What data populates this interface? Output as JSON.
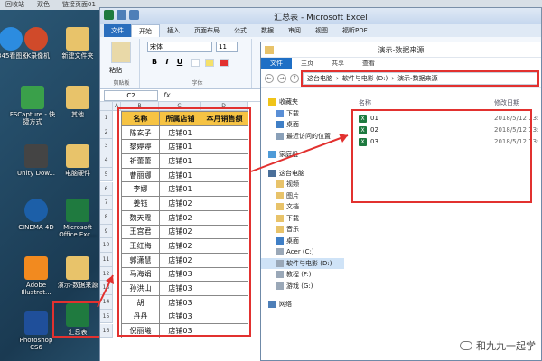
{
  "taskbar": {
    "items": [
      "回收站",
      "双色",
      "链接页面01"
    ]
  },
  "desktop_icons": [
    {
      "label": "2345看图王",
      "color": "#2c8ce0"
    },
    {
      "label": "KK录像机",
      "color": "#d04a2a"
    },
    {
      "label": "新建文件夹",
      "color": "#e8c36a"
    },
    {
      "label": "FSCapture - 快捷方式",
      "color": "#3aa04a"
    },
    {
      "label": "其他",
      "color": "#e8c36a"
    },
    {
      "label": "Unity Dow...",
      "color": "#444444"
    },
    {
      "label": "电脑硬件",
      "color": "#e8c36a"
    },
    {
      "label": "CINEMA 4D",
      "color": "#1c5fa8"
    },
    {
      "label": "Microsoft Office Exc...",
      "color": "#1f7a3f"
    },
    {
      "label": "Adobe Illustrat...",
      "color": "#f28a1f"
    },
    {
      "label": "演示-数据来源",
      "color": "#e8c36a"
    },
    {
      "label": "Photoshop CS6",
      "color": "#1f4f9a"
    },
    {
      "label": "汇总表",
      "color": "#1f7a3f"
    }
  ],
  "excel": {
    "title": "汇总表 - Microsoft Excel",
    "tabs": [
      "文件",
      "开始",
      "插入",
      "页面布局",
      "公式",
      "数据",
      "审阅",
      "视图",
      "福昕PDF"
    ],
    "ribbon": {
      "paste_label": "粘贴",
      "clipboard_label": "剪贴板",
      "font_name": "宋体",
      "font_size": "11",
      "bold": "B",
      "italic": "I",
      "underline": "U",
      "font_group_label": "字体"
    },
    "name_box": "C2",
    "fx_label": "fx",
    "columns": [
      "A",
      "B",
      "C",
      "D"
    ],
    "row_numbers": [
      "1",
      "2",
      "3",
      "4",
      "5",
      "6",
      "7",
      "8",
      "9",
      "10",
      "11",
      "12",
      "13",
      "14",
      "15",
      "16"
    ],
    "table": {
      "headers": [
        "名称",
        "所属店铺",
        "本月销售额"
      ],
      "rows": [
        [
          "陈玄子",
          "店铺01",
          ""
        ],
        [
          "黎婷婷",
          "店铺01",
          ""
        ],
        [
          "祈蕾蕾",
          "店铺01",
          ""
        ],
        [
          "曹丽娜",
          "店铺01",
          ""
        ],
        [
          "李娜",
          "店铺01",
          ""
        ],
        [
          "姜钰",
          "店铺02",
          ""
        ],
        [
          "魏天霞",
          "店铺02",
          ""
        ],
        [
          "王宫君",
          "店铺02",
          ""
        ],
        [
          "王红梅",
          "店铺02",
          ""
        ],
        [
          "郭潇慧",
          "店铺02",
          ""
        ],
        [
          "马海娟",
          "店铺03",
          ""
        ],
        [
          "孙洪山",
          "店铺03",
          ""
        ],
        [
          "胡",
          "店铺03",
          ""
        ],
        [
          "丹丹",
          "店铺03",
          ""
        ],
        [
          "倪丽曦",
          "店铺03",
          ""
        ]
      ]
    }
  },
  "explorer": {
    "title": "演示-数据来源",
    "tabs": [
      "文件",
      "主页",
      "共享",
      "查看"
    ],
    "address": [
      "这台电脑",
      "软件与电影 (D:)",
      "演示-数据来源"
    ],
    "columns": {
      "name": "名称",
      "date": "修改日期"
    },
    "files": [
      {
        "name": "01",
        "date": "2018/5/12 13:"
      },
      {
        "name": "02",
        "date": "2018/5/12 13:"
      },
      {
        "name": "03",
        "date": "2018/5/12 13:"
      }
    ],
    "sidebar": {
      "favorites_label": "收藏夹",
      "favorites": [
        "下载",
        "桌面",
        "最近访问的位置"
      ],
      "homegroup": "家庭组",
      "pc_label": "这台电脑",
      "pc_items": [
        "视频",
        "图片",
        "文档",
        "下载",
        "音乐",
        "桌面"
      ],
      "drives": [
        "Acer (C:)",
        "软件与电影 (D:)",
        "教程 (F:)",
        "游戏 (G:)"
      ],
      "network": "网络"
    }
  },
  "watermark": "和九九一起学"
}
